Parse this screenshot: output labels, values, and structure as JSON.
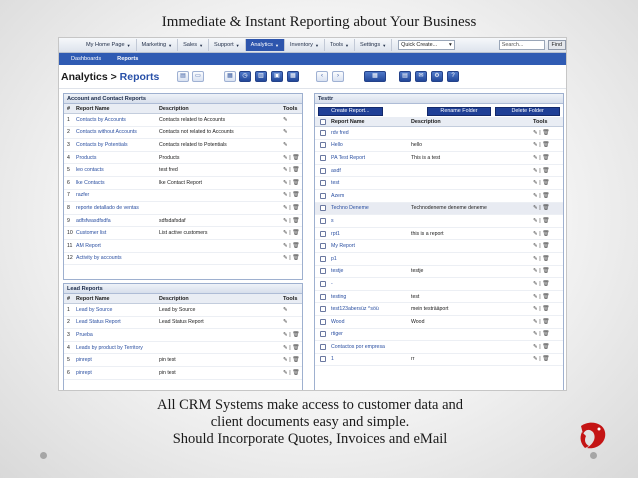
{
  "slide": {
    "title": "Immediate & Instant Reporting about Your Business",
    "caption_lines": [
      "All CRM Systems make access to customer data and",
      "client documents easy and simple.",
      "Should Incorporate Quotes, Invoices and eMail"
    ]
  },
  "app": {
    "menu": [
      {
        "label": "My Home Page",
        "active": false
      },
      {
        "label": "Marketing",
        "active": false
      },
      {
        "label": "Sales",
        "active": false
      },
      {
        "label": "Support",
        "active": false
      },
      {
        "label": "Analytics",
        "active": true
      },
      {
        "label": "Inventory",
        "active": false
      },
      {
        "label": "Tools",
        "active": false
      },
      {
        "label": "Settings",
        "active": false
      }
    ],
    "quick_create": "Quick Create...",
    "search_value": "Search...",
    "find_label": "Find",
    "subnav": [
      "Dashboards",
      "Reports"
    ],
    "page_title_prefix": "Analytics > ",
    "page_title_accent": "Reports"
  },
  "account_panel": {
    "title": "Account and Contact Reports",
    "columns": [
      "#",
      "Report Name",
      "Description",
      "Tools"
    ],
    "rows": [
      {
        "num": "1",
        "name": "Contacts by Accounts",
        "desc": "Contacts related to Accounts",
        "tools": "✎"
      },
      {
        "num": "2",
        "name": "Contacts without Accounts",
        "desc": "Contacts not related to Accounts",
        "tools": "✎"
      },
      {
        "num": "3",
        "name": "Contacts by Potentials",
        "desc": "Contacts related to Potentials",
        "tools": "✎"
      },
      {
        "num": "4",
        "name": "Products",
        "desc": "Products",
        "tools": "✎ | 🗑"
      },
      {
        "num": "5",
        "name": "lео contacts",
        "desc": "test fred",
        "tools": "✎ | 🗑"
      },
      {
        "num": "6",
        "name": "lke Contacts",
        "desc": "lke Contact Report",
        "tools": "✎ | 🗑"
      },
      {
        "num": "7",
        "name": "razfer",
        "desc": "",
        "tools": "✎ | 🗑"
      },
      {
        "num": "8",
        "name": "reporte detallado de ventas",
        "desc": "",
        "tools": "✎ | 🗑"
      },
      {
        "num": "9",
        "name": "adfsfwasdfsdfa",
        "desc": "sdfsdafsdaf",
        "tools": "✎ | 🗑"
      },
      {
        "num": "10",
        "name": "Customer list",
        "desc": "List active customers",
        "tools": "✎ | 🗑"
      },
      {
        "num": "11",
        "name": "AM Report",
        "desc": "",
        "tools": "✎ | 🗑"
      },
      {
        "num": "12",
        "name": "Activity by accounts",
        "desc": "",
        "tools": "✎ | 🗑"
      }
    ]
  },
  "lead_panel": {
    "title": "Lead Reports",
    "columns": [
      "#",
      "Report Name",
      "Description",
      "Tools"
    ],
    "rows": [
      {
        "num": "1",
        "name": "Lead by Source",
        "desc": "Lead by Source",
        "tools": "✎"
      },
      {
        "num": "2",
        "name": "Lead Status Report",
        "desc": "Lead Status Report",
        "tools": "✎"
      },
      {
        "num": "3",
        "name": "Prueba",
        "desc": "",
        "tools": "✎ | 🗑"
      },
      {
        "num": "4",
        "name": "Leads by product by Territory",
        "desc": "",
        "tools": "✎ | 🗑"
      },
      {
        "num": "5",
        "name": "pinrept",
        "desc": "pin test",
        "tools": "✎ | 🗑"
      },
      {
        "num": "6",
        "name": "pinrept",
        "desc": "pin test",
        "tools": "✎ | 🗑"
      }
    ]
  },
  "folder_panel": {
    "title": "Testtr",
    "create_label": "Create Report...",
    "rename_label": "Rename Folder",
    "delete_label": "Delete Folder",
    "columns": [
      "Report Name",
      "Description",
      "Tools"
    ],
    "rows": [
      {
        "name": "rdv fred",
        "desc": "",
        "tools": "✎ | 🗑",
        "hl": false
      },
      {
        "name": "Hello",
        "desc": "hello",
        "tools": "✎ | 🗑",
        "hl": false
      },
      {
        "name": "PA Test Report",
        "desc": "This is a test",
        "tools": "✎ | 🗑",
        "hl": false
      },
      {
        "name": "asdf",
        "desc": "",
        "tools": "✎ | 🗑",
        "hl": false
      },
      {
        "name": "test",
        "desc": "",
        "tools": "✎ | 🗑",
        "hl": false
      },
      {
        "name": "Azem",
        "desc": "",
        "tools": "✎ | 🗑",
        "hl": false
      },
      {
        "name": "Techno Deneme",
        "desc": "Technodeneme deneme deneme",
        "tools": "✎ | 🗑",
        "hl": true
      },
      {
        "name": "s",
        "desc": "",
        "tools": "✎ | 🗑",
        "hl": false
      },
      {
        "name": "rpt1",
        "desc": "this is a report",
        "tools": "✎ | 🗑",
        "hl": false
      },
      {
        "name": "My Report",
        "desc": "",
        "tools": "✎ | 🗑",
        "hl": false
      },
      {
        "name": "p1",
        "desc": "",
        "tools": "✎ | 🗑",
        "hl": false
      },
      {
        "name": "testje",
        "desc": "testje",
        "tools": "✎ | 🗑",
        "hl": false
      },
      {
        "name": "-",
        "desc": "",
        "tools": "✎ | 🗑",
        "hl": false
      },
      {
        "name": "testing",
        "desc": "test",
        "tools": "✎ | 🗑",
        "hl": false
      },
      {
        "name": "test123abersüz ^söü",
        "desc": "mein testrääport",
        "tools": "✎ | 🗑",
        "hl": false
      },
      {
        "name": "Wood",
        "desc": "Wood",
        "tools": "✎ | 🗑",
        "hl": false
      },
      {
        "name": "rtiger",
        "desc": "",
        "tools": "✎ | 🗑",
        "hl": false
      },
      {
        "name": "Contactos por empresa",
        "desc": "",
        "tools": "✎ | 🗑",
        "hl": false
      },
      {
        "name": "1",
        "desc": "rr",
        "tools": "✎ | 🗑",
        "hl": false
      }
    ]
  }
}
